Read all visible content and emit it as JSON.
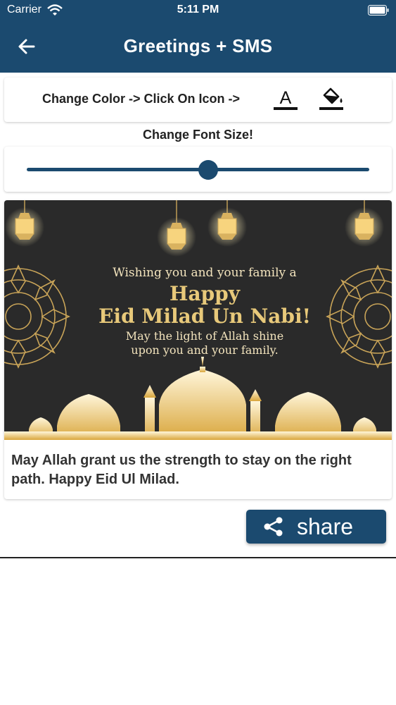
{
  "status_bar": {
    "carrier": "Carrier",
    "time": "5:11 PM"
  },
  "header": {
    "title": "Greetings + SMS"
  },
  "color_options": {
    "label": "Change Color -> Click On Icon ->",
    "font_icon_letter": "A"
  },
  "font_size": {
    "label": "Change Font Size!",
    "slider_value": 0.53
  },
  "greeting_image": {
    "line1": "Wishing you and your family a",
    "line2": "Happy",
    "line3": "Eid Milad Un Nabi!",
    "line4": "May the light of Allah shine",
    "line5": "upon you and your family."
  },
  "message": "May Allah grant us the strength to stay on the right path. Happy Eid Ul Milad.",
  "share_button": {
    "label": "share"
  },
  "colors": {
    "primary": "#1b4a6f",
    "gold": "#e8c97a",
    "card_bg": "#2b2b2b"
  },
  "icons": [
    "back-arrow-icon",
    "font-color-icon",
    "fill-color-icon",
    "share-icon",
    "wifi-icon",
    "battery-icon"
  ]
}
